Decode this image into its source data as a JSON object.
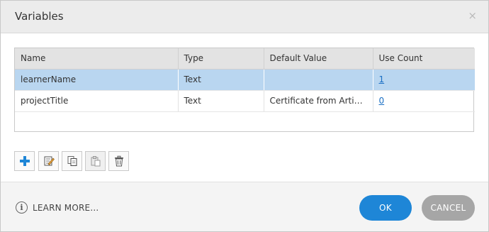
{
  "dialog": {
    "title": "Variables",
    "close_glyph": "×"
  },
  "table": {
    "headers": [
      "Name",
      "Type",
      "Default Value",
      "Use Count"
    ],
    "rows": [
      {
        "name": "learnerName",
        "type": "Text",
        "default": "",
        "use_count": "1",
        "selected": true
      },
      {
        "name": "projectTitle",
        "type": "Text",
        "default": "Certificate from Articul…",
        "use_count": "0",
        "selected": false
      }
    ]
  },
  "toolbar": {
    "buttons": [
      {
        "icon": "add-icon",
        "enabled": true
      },
      {
        "icon": "edit-icon",
        "enabled": true
      },
      {
        "icon": "duplicate-icon",
        "enabled": true
      },
      {
        "icon": "paste-icon",
        "enabled": false
      },
      {
        "icon": "delete-icon",
        "enabled": true
      }
    ]
  },
  "footer": {
    "learn_more": "LEARN MORE...",
    "info_glyph": "i",
    "ok_label": "OK",
    "cancel_label": "CANCEL"
  },
  "colors": {
    "selection": "#b9d6f0",
    "primary": "#1e86d7",
    "secondary": "#a6a6a6",
    "add_icon": "#1e86d7"
  }
}
